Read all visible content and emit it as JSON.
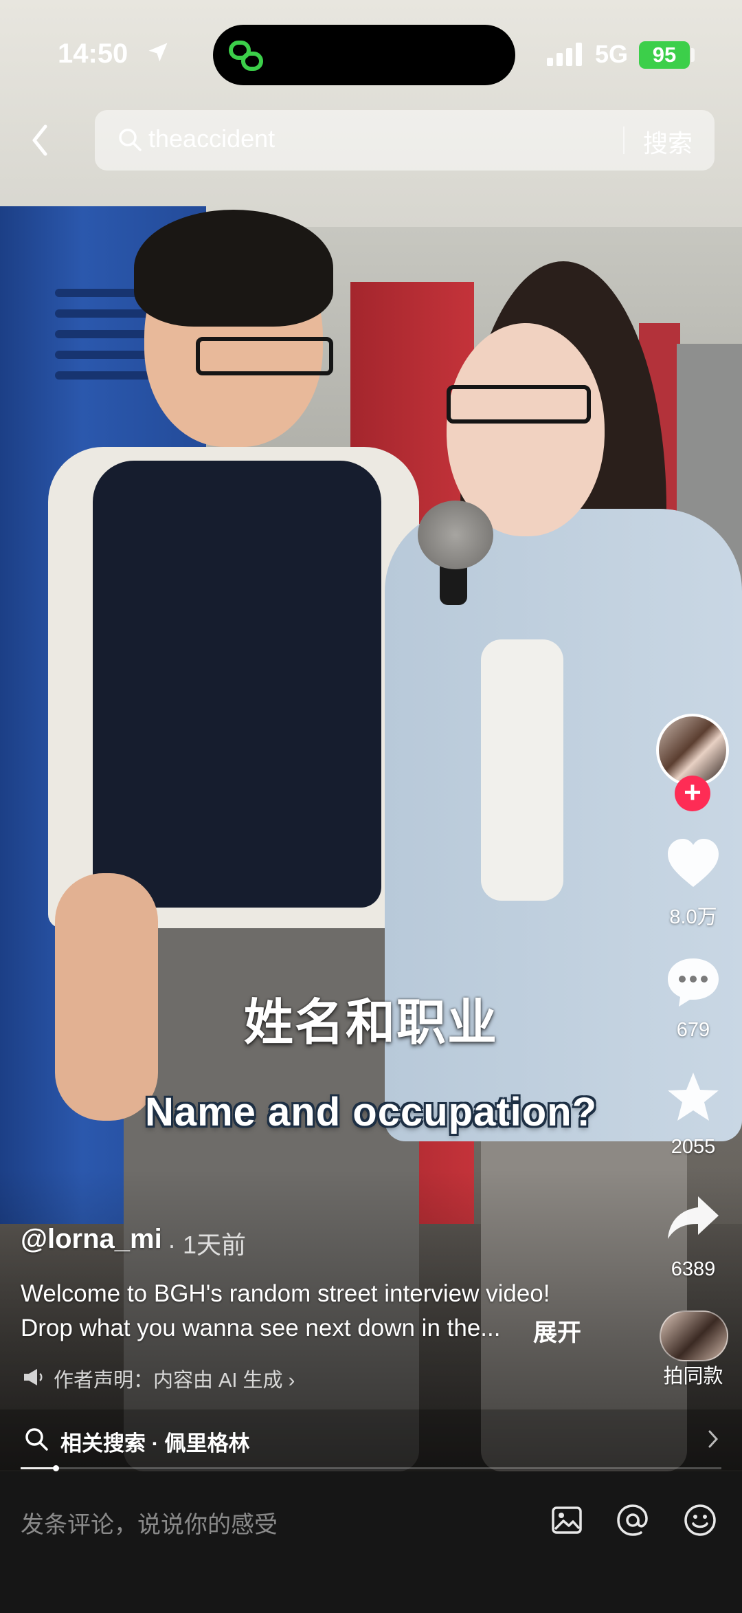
{
  "status_bar": {
    "time": "14:50",
    "network": "5G",
    "battery": "95"
  },
  "search": {
    "query": "theaccident",
    "button": "搜索"
  },
  "video": {
    "subtitle_cn": "姓名和职业",
    "subtitle_en": "Name and occupation?"
  },
  "actions": {
    "likes": "8.0万",
    "comments": "679",
    "favorites": "2055",
    "shares": "6389",
    "same_style": "拍同款",
    "follow_symbol": "+"
  },
  "caption": {
    "author": "@lorna_mi",
    "time": "· 1天前",
    "line1": "Welcome to BGH's random street interview video!",
    "line2": "Drop what you wanna see next down in the...",
    "expand": "展开",
    "ai_note": "作者声明：内容由 AI 生成 ›"
  },
  "related": {
    "label": "相关搜索 · 佩里格林"
  },
  "playback": {
    "progress": 0.05
  },
  "comment_bar": {
    "placeholder": "发条评论，说说你的感受"
  },
  "icons": {
    "back": "chevron-left-icon",
    "search": "search-icon",
    "like": "heart-icon",
    "comment": "comment-bubble-icon",
    "favorite": "star-icon",
    "share": "share-arrow-icon",
    "image": "image-icon",
    "mention": "at-icon",
    "emoji": "emoji-icon"
  },
  "colors": {
    "accent": "#fe2c55",
    "battery": "#3ccf4a",
    "island_icon": "#3ccf4a"
  }
}
